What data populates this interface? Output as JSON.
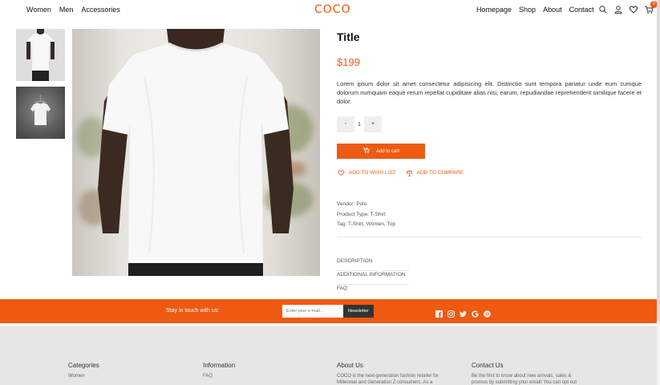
{
  "header": {
    "logo": "COCO",
    "nav_left": [
      "Women",
      "Men",
      "Accessories"
    ],
    "nav_right": [
      "Homepage",
      "Shop",
      "About",
      "Contact"
    ],
    "cart_count": "0",
    "icons": [
      "search-icon",
      "user-icon",
      "heart-icon",
      "cart-icon"
    ]
  },
  "product": {
    "title": "Title",
    "price": "$199",
    "description": "Lorem ipsum dolor sit amet consectetur adipisicing elit. Distinctio sunt tempora pariatur unde eum cumque dolorum numquam eaque rerum repellat cupiditate alias nisi, earum, repudiandae reprehenderit similique facere et dolor.",
    "quantity": "1",
    "minus_label": "-",
    "plus_label": "+",
    "add_to_cart": "Add to cart",
    "wish_list": "ADD TO WISH LIST",
    "compare": "ADD TO COMPARE",
    "vendor": "Vendor: Polo",
    "product_type": "Product Type: T-Shirt",
    "tags": "Tag: T-Shirt, Women, Top",
    "tabs": [
      "DESCRIPTION",
      "ADDITIONAL INFORMATION",
      "FAQ"
    ]
  },
  "newsletter": {
    "label": "Stay in touch with us:",
    "placeholder": "Enter your e-mail...",
    "button": "Newsletter",
    "social_icons": [
      "facebook-icon",
      "instagram-icon",
      "twitter-icon",
      "google-icon",
      "pinterest-icon"
    ]
  },
  "footer": {
    "categories_title": "Categories",
    "categories_item": "Women",
    "information_title": "Information",
    "information_item": "FAQ",
    "about_title": "About Us",
    "about_text": "COCO is the next-generation fashion retailer for Millennial and Generation Z consumers. As a",
    "contact_title": "Contact Us",
    "contact_text": "Be the first to know about new arrivals, sales & promos by submitting your email! You can opt out"
  },
  "colors": {
    "accent": "#ee5a12",
    "footer_bg": "#e6e6e6",
    "dark_button": "#333333"
  }
}
